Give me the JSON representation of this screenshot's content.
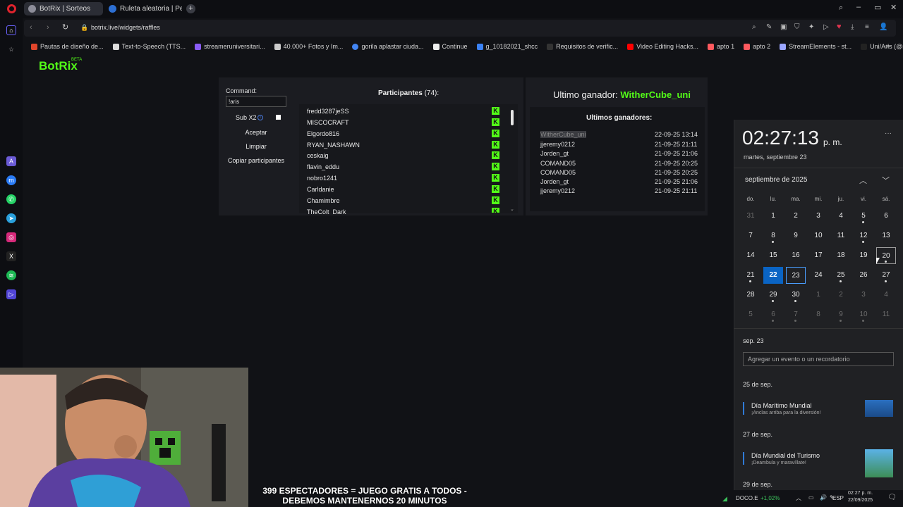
{
  "browser": {
    "tabs": [
      {
        "label": "BotRix | Sorteos",
        "active": true
      },
      {
        "label": "Ruleta aleatoria | Personal",
        "active": false
      }
    ],
    "url": "botrix.live/widgets/raffles",
    "bookmarks": [
      "Pautas de diseño de...",
      "Text-to-Speech (TTS...",
      "streameruniversitari...",
      "40.000+ Fotos y Im...",
      "gorila aplastar ciuda...",
      "Continue",
      "g_10182021_shcc",
      "Requisitos de verific...",
      "Video Editing Hacks...",
      "apto 1",
      "apto 2",
      "StreamElements - st...",
      "Uni/Aris (@streame..."
    ]
  },
  "app": {
    "logo": "BotRix",
    "logo_badge": "BETA",
    "command_label": "Command:",
    "command_value": "!aris",
    "sub_label": "Sub X2",
    "buttons": {
      "accept": "Aceptar",
      "clear": "Limpiar",
      "copy": "Copiar participantes"
    },
    "participants_label": "Participantes",
    "participants_count": "(74):",
    "participants": [
      "fredd3287jeSS",
      "MISCOCRAFT",
      "Elgordo816",
      "RYAN_NASHAWN",
      "ceskaig",
      "flavin_eddu",
      "nobro1241",
      "Carldanie",
      "Chamimbre",
      "TheColt_Dark"
    ],
    "last_winner_label": "Ultimo ganador:",
    "last_winner": "WitherCube_uni",
    "winners_title": "Ultimos ganadores:",
    "winners": [
      {
        "name": "WitherCube_uni",
        "date": "22-09-25 13:14"
      },
      {
        "name": "jjeremy0212",
        "date": "21-09-25 21:11"
      },
      {
        "name": "Jorden_gt",
        "date": "21-09-25 21:06"
      },
      {
        "name": "COMAND05",
        "date": "21-09-25 20:25"
      },
      {
        "name": "COMAND05",
        "date": "21-09-25 20:25"
      },
      {
        "name": "Jorden_gt",
        "date": "21-09-25 21:06"
      },
      {
        "name": "jjeremy0212",
        "date": "21-09-25 21:11"
      }
    ]
  },
  "calendar": {
    "time": "02:27:13",
    "ampm": "p. m.",
    "date_long": "martes, septiembre 23",
    "month_label": "septiembre de 2025",
    "weekdays": [
      "do.",
      "lu.",
      "ma.",
      "mi.",
      "ju.",
      "vi.",
      "sá."
    ],
    "weeks": [
      [
        "31",
        "1",
        "2",
        "3",
        "4",
        "5",
        "6"
      ],
      [
        "7",
        "8",
        "9",
        "10",
        "11",
        "12",
        "13"
      ],
      [
        "14",
        "15",
        "16",
        "17",
        "18",
        "19",
        "20"
      ],
      [
        "21",
        "22",
        "23",
        "24",
        "25",
        "26",
        "27"
      ],
      [
        "28",
        "29",
        "30",
        "1",
        "2",
        "3",
        "4"
      ],
      [
        "5",
        "6",
        "7",
        "8",
        "9",
        "10",
        "11"
      ]
    ],
    "selected_heading": "sep. 23",
    "add_event_placeholder": "Agregar un evento o un recordatorio",
    "events": [
      {
        "heading": "25 de sep.",
        "title": "Día Marítimo Mundial",
        "subtitle": "¡Anclas arriba para la diversión!"
      },
      {
        "heading": "27 de sep.",
        "title": "Día Mundial del Turismo",
        "subtitle": "¡Deambula y maravíllate!"
      }
    ],
    "next_heading": "29 de sep."
  },
  "overlay": {
    "line1": "399 ESPECTADORES = JUEGO GRATIS A TODOS -",
    "line2": "DEBEMOS MANTENERNOS 20 MINUTOS"
  },
  "taskbar": {
    "ticker": "DOCO.E",
    "ticker_change": "+1,02%",
    "lang": "ESP",
    "clock_time": "02:27 p. m.",
    "clock_date": "22/09/2025"
  },
  "colors": {
    "accent": "#53fc18",
    "today": "#0a64c4"
  }
}
